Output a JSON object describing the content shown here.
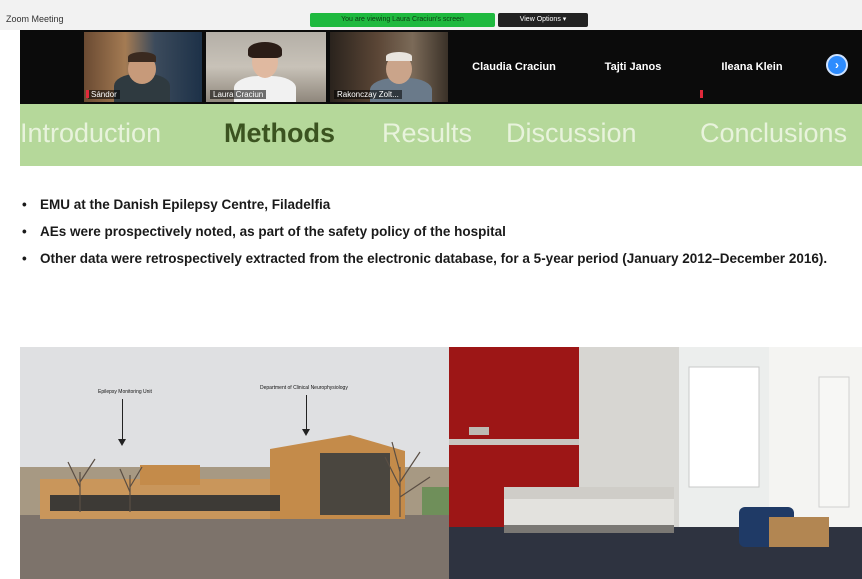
{
  "window": {
    "title": "Zoom Meeting",
    "share_banner": "You are viewing Laura Craciun's screen",
    "view_options": "View Options ▾"
  },
  "participants": {
    "video": [
      {
        "name": "Sándor"
      },
      {
        "name": "Laura Craciun"
      },
      {
        "name": "Rakonczay Zolt..."
      }
    ],
    "names_only": [
      {
        "name": "Claudia Craciun"
      },
      {
        "name": "Tajti Janos"
      },
      {
        "name": "Ileana Klein"
      }
    ],
    "next_icon": "chevron-right-icon"
  },
  "slide": {
    "tabs": [
      {
        "label": "Introduction",
        "active": false
      },
      {
        "label": "Methods",
        "active": true
      },
      {
        "label": "Results",
        "active": false
      },
      {
        "label": "Discussion",
        "active": false
      },
      {
        "label": "Conclusions",
        "active": false
      }
    ],
    "bullets": [
      "EMU at the Danish Epilepsy Centre, Filadelfia",
      "AEs  were prospectively noted, as part of the safety policy of the hospital",
      "Other data were retrospectively extracted from the electronic database, for a 5-year period (January 2012–December 2016)."
    ],
    "photo_annotations": [
      "Epilepsy Monitoring Unit",
      "Department of Clinical Neurophysiology"
    ]
  },
  "colors": {
    "nav_bg": "#b5d89a",
    "active_tab": "#3b5320",
    "inactive_tab": "#e8f3dc",
    "banner_green": "#1fb93f",
    "zoom_blue": "#2d8cff"
  }
}
